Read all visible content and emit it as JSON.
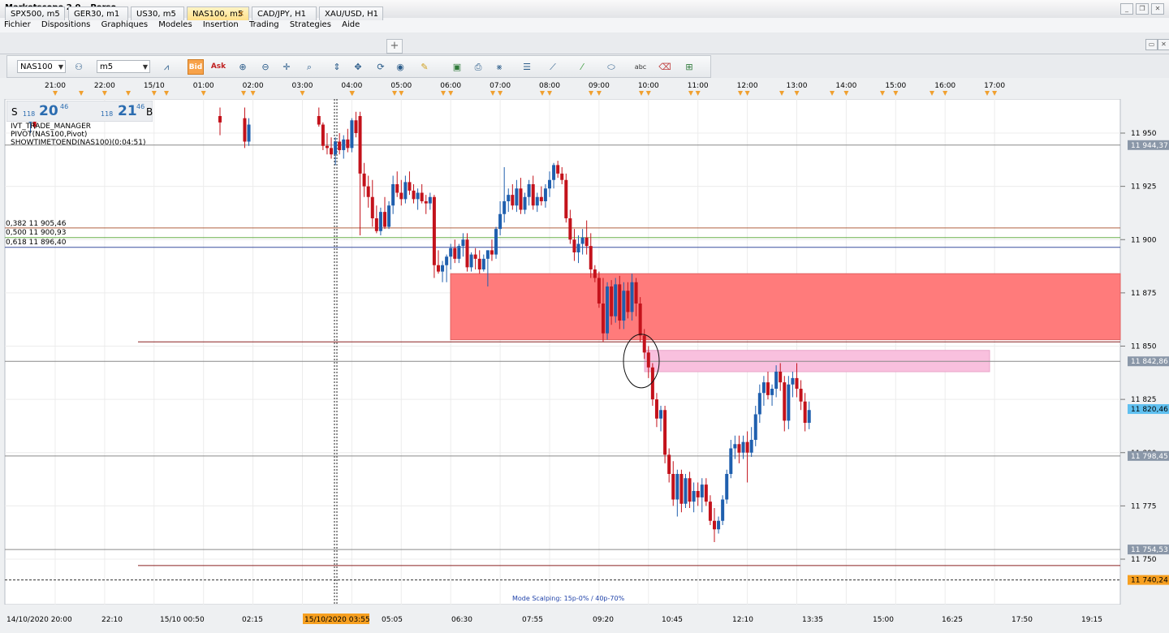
{
  "app": {
    "title": "Marketscope 2.0 – Perso",
    "window_buttons": [
      "_",
      "❐",
      "✕"
    ]
  },
  "menu": [
    "Fichier",
    "Dispositions",
    "Graphiques",
    "Modeles",
    "Insertion",
    "Trading",
    "Strategies",
    "Aide"
  ],
  "tabs": [
    {
      "label": "SPX500, m5",
      "active": false
    },
    {
      "label": "GER30, m1",
      "active": false
    },
    {
      "label": "US30, m5",
      "active": false
    },
    {
      "label": "NAS100, m5",
      "active": true
    },
    {
      "label": "CAD/JPY, H1",
      "active": false
    },
    {
      "label": "XAU/USD, H1",
      "active": false
    }
  ],
  "toolbar": {
    "instrument": "NAS100",
    "timeframe": "m5",
    "bid_label": "Bid",
    "ask_label": "Ask"
  },
  "quote": {
    "sell_label": "S",
    "sell_small": "118",
    "sell_big": "20",
    "sell_sup": "46",
    "buy_small": "118",
    "buy_big": "21",
    "buy_sup": "46",
    "buy_label": "B"
  },
  "indicators": [
    "IVT_TRADE_MANAGER",
    "PIVOT(NAS100,Pivot)",
    "SHOWTIMETOEND(NAS100)(0:04:51)"
  ],
  "fib_labels": [
    "0,382 11 905,46",
    "0,500 11 900,93",
    "0,618 11 896,40"
  ],
  "mode_label": "Mode Scalping: 15p-0% / 40p-70%",
  "colors": {
    "bull": "#1f5fae",
    "bear": "#c3121b",
    "zone_red": "#ff7b7b",
    "zone_pink": "#f9c0de",
    "accent": "#f7a24a"
  },
  "chart_data": {
    "type": "candlestick",
    "symbol": "NAS100",
    "timeframe": "m5",
    "ylim": [
      11732,
      11960
    ],
    "y_ticks": [
      "11 950",
      "11 925",
      "11 900",
      "11 875",
      "11 850",
      "11 825",
      "11 800",
      "11 775",
      "11 750"
    ],
    "top_time_labels": [
      "21:00",
      "22:00",
      "15/10",
      "01:00",
      "02:00",
      "03:00",
      "04:00",
      "05:00",
      "06:00",
      "07:00",
      "08:00",
      "09:00",
      "10:00",
      "11:00",
      "12:00",
      "13:00",
      "14:00",
      "15:00",
      "16:00",
      "17:00"
    ],
    "bottom_time_labels": [
      "14/10/2020 20:00",
      "22:10",
      "15/10 00:50",
      "02:15",
      "03:40",
      "15/10/2020 03:55",
      "05:05",
      "06:30",
      "07:55",
      "09:20",
      "10:45",
      "12:10",
      "13:35",
      "15:00",
      "16:25",
      "17:50",
      "19:15"
    ],
    "price_tags": [
      {
        "label": "11 944,37",
        "value": 11944.37,
        "style": "gray"
      },
      {
        "label": "11 842,86",
        "value": 11842.86,
        "style": "gray"
      },
      {
        "label": "11 820,46",
        "value": 11820.46,
        "style": "blue"
      },
      {
        "label": "11 798,45",
        "value": 11798.45,
        "style": "gray"
      },
      {
        "label": "11 754,53",
        "value": 11754.53,
        "style": "gray"
      },
      {
        "label": "11 740,24",
        "value": 11740.24,
        "style": "orange"
      }
    ],
    "horizontal_lines": [
      {
        "value": 11944.37,
        "color": "#8a8a8a"
      },
      {
        "value": 11905.46,
        "color": "#b06040"
      },
      {
        "value": 11900.93,
        "color": "#6ab04c"
      },
      {
        "value": 11896.4,
        "color": "#3a50a0"
      },
      {
        "value": 11852,
        "color": "#8b2020"
      },
      {
        "value": 11842.86,
        "color": "#8a8a8a"
      },
      {
        "value": 11798.45,
        "color": "#8a8a8a"
      },
      {
        "value": 11754.53,
        "color": "#8a8a8a"
      },
      {
        "value": 11747,
        "color": "#8b2020"
      },
      {
        "value": 11740.24,
        "color": "#333333",
        "dashed": true
      }
    ],
    "zones": [
      {
        "name": "supply-zone",
        "from_time": "06:20",
        "to_time": "end",
        "high": 11884,
        "low": 11853,
        "color": "#ff7b7b"
      },
      {
        "name": "imbalance-zone",
        "from_time": "09:55",
        "to_time": "16:55",
        "high": 11848,
        "low": 11838,
        "color": "#f9c0de"
      }
    ],
    "candles": [
      [
        "20:30",
        11955,
        11960,
        11950,
        11957
      ],
      [
        "20:35",
        11957,
        11962,
        11952,
        11953
      ],
      [
        "00:20",
        11958,
        11962,
        11949,
        11955
      ],
      [
        "00:50",
        11957,
        11962,
        11943,
        11946
      ],
      [
        "00:55",
        11946,
        11957,
        11944,
        11954
      ],
      [
        "02:20",
        11958,
        11962,
        11953,
        11954
      ],
      [
        "02:25",
        11954,
        11955,
        11942,
        11944
      ],
      [
        "02:30",
        11944,
        11950,
        11940,
        11943
      ],
      [
        "02:35",
        11943,
        11948,
        11938,
        11940
      ],
      [
        "02:40",
        11940,
        11948,
        11935,
        11946
      ],
      [
        "02:45",
        11946,
        11950,
        11940,
        11942
      ],
      [
        "02:50",
        11942,
        11949,
        11938,
        11947
      ],
      [
        "02:55",
        11947,
        11952,
        11941,
        11943
      ],
      [
        "03:00",
        11943,
        11957,
        11941,
        11956
      ],
      [
        "03:05",
        11956,
        11960,
        11948,
        11950
      ],
      [
        "03:10",
        11958,
        11960,
        11902,
        11931
      ],
      [
        "03:15",
        11931,
        11936,
        11920,
        11925
      ],
      [
        "03:20",
        11925,
        11930,
        11915,
        11920
      ],
      [
        "03:25",
        11920,
        11928,
        11906,
        11910
      ],
      [
        "03:30",
        11910,
        11916,
        11903,
        11904
      ],
      [
        "03:35",
        11904,
        11915,
        11902,
        11913
      ],
      [
        "03:40",
        11913,
        11920,
        11905,
        11906
      ],
      [
        "03:45",
        11906,
        11918,
        11905,
        11916
      ],
      [
        "03:50",
        11916,
        11930,
        11912,
        11926
      ],
      [
        "03:55",
        11926,
        11932,
        11920,
        11922
      ],
      [
        "04:00",
        11922,
        11928,
        11916,
        11919
      ],
      [
        "04:05",
        11919,
        11930,
        11917,
        11927
      ],
      [
        "04:10",
        11927,
        11932,
        11921,
        11923
      ],
      [
        "04:15",
        11923,
        11926,
        11917,
        11919
      ],
      [
        "04:20",
        11919,
        11924,
        11914,
        11922
      ],
      [
        "04:25",
        11922,
        11926,
        11917,
        11918
      ],
      [
        "04:30",
        11918,
        11921,
        11912,
        11917
      ],
      [
        "04:35",
        11917,
        11922,
        11914,
        11920
      ],
      [
        "04:40",
        11920,
        11921,
        11882,
        11888
      ],
      [
        "04:45",
        11888,
        11895,
        11884,
        11885
      ],
      [
        "04:50",
        11885,
        11890,
        11880,
        11888
      ],
      [
        "04:55",
        11888,
        11893,
        11880,
        11892
      ],
      [
        "05:00",
        11892,
        11898,
        11886,
        11896
      ],
      [
        "05:05",
        11896,
        11900,
        11889,
        11891
      ],
      [
        "05:10",
        11891,
        11898,
        11889,
        11897
      ],
      [
        "05:15",
        11897,
        11903,
        11892,
        11900
      ],
      [
        "05:20",
        11900,
        11903,
        11885,
        11887
      ],
      [
        "05:25",
        11887,
        11894,
        11885,
        11893
      ],
      [
        "05:30",
        11893,
        11896,
        11886,
        11891
      ],
      [
        "05:35",
        11891,
        11895,
        11884,
        11886
      ],
      [
        "05:40",
        11886,
        11893,
        11885,
        11891
      ],
      [
        "05:45",
        11891,
        11895,
        11878,
        11895
      ],
      [
        "05:50",
        11895,
        11900,
        11890,
        11893
      ],
      [
        "05:55",
        11893,
        11906,
        11891,
        11905
      ],
      [
        "06:00",
        11905,
        11918,
        11902,
        11912
      ],
      [
        "06:05",
        11912,
        11934,
        11908,
        11918
      ],
      [
        "06:10",
        11918,
        11924,
        11913,
        11921
      ],
      [
        "06:15",
        11921,
        11926,
        11914,
        11916
      ],
      [
        "06:20",
        11916,
        11928,
        11913,
        11924
      ],
      [
        "06:25",
        11924,
        11929,
        11912,
        11914
      ],
      [
        "06:30",
        11914,
        11922,
        11912,
        11920
      ],
      [
        "06:35",
        11920,
        11928,
        11916,
        11926
      ],
      [
        "06:40",
        11926,
        11930,
        11914,
        11916
      ],
      [
        "06:45",
        11916,
        11922,
        11913,
        11920
      ],
      [
        "06:50",
        11920,
        11925,
        11916,
        11918
      ],
      [
        "06:55",
        11918,
        11926,
        11915,
        11924
      ],
      [
        "07:00",
        11924,
        11932,
        11920,
        11928
      ],
      [
        "07:05",
        11928,
        11936,
        11924,
        11935
      ],
      [
        "07:10",
        11935,
        11937,
        11929,
        11931
      ],
      [
        "07:15",
        11931,
        11934,
        11926,
        11928
      ],
      [
        "07:20",
        11928,
        11931,
        11908,
        11910
      ],
      [
        "07:25",
        11910,
        11914,
        11898,
        11900
      ],
      [
        "07:30",
        11900,
        11905,
        11890,
        11894
      ],
      [
        "07:35",
        11894,
        11902,
        11889,
        11898
      ],
      [
        "07:40",
        11898,
        11905,
        11893,
        11901
      ],
      [
        "07:45",
        11901,
        11909,
        11893,
        11897
      ],
      [
        "07:50",
        11897,
        11903,
        11882,
        11886
      ],
      [
        "07:55",
        11886,
        11888,
        11880,
        11882
      ],
      [
        "08:00",
        11882,
        11885,
        11868,
        11870
      ],
      [
        "08:05",
        11870,
        11882,
        11852,
        11856
      ],
      [
        "08:10",
        11856,
        11880,
        11853,
        11878
      ],
      [
        "08:15",
        11878,
        11881,
        11860,
        11864
      ],
      [
        "08:20",
        11864,
        11882,
        11861,
        11879
      ],
      [
        "08:25",
        11879,
        11883,
        11858,
        11862
      ],
      [
        "08:30",
        11862,
        11880,
        11858,
        11876
      ],
      [
        "08:35",
        11876,
        11880,
        11863,
        11866
      ],
      [
        "08:40",
        11866,
        11884,
        11862,
        11880
      ],
      [
        "08:45",
        11880,
        11882,
        11864,
        11870
      ],
      [
        "08:50",
        11870,
        11873,
        11852,
        11855
      ],
      [
        "08:55",
        11855,
        11858,
        11844,
        11847
      ],
      [
        "09:00",
        11847,
        11850,
        11835,
        11840
      ],
      [
        "09:05",
        11840,
        11842,
        11822,
        11825
      ],
      [
        "09:10",
        11825,
        11828,
        11812,
        11816
      ],
      [
        "09:15",
        11816,
        11822,
        11810,
        11820
      ],
      [
        "09:20",
        11820,
        11822,
        11795,
        11799
      ],
      [
        "09:25",
        11799,
        11802,
        11786,
        11790
      ],
      [
        "09:30",
        11790,
        11796,
        11775,
        11778
      ],
      [
        "09:35",
        11778,
        11792,
        11770,
        11790
      ],
      [
        "09:40",
        11790,
        11792,
        11772,
        11776
      ],
      [
        "09:45",
        11776,
        11790,
        11774,
        11788
      ],
      [
        "09:50",
        11788,
        11791,
        11774,
        11777
      ],
      [
        "09:55",
        11777,
        11786,
        11772,
        11782
      ],
      [
        "10:00",
        11782,
        11786,
        11775,
        11779
      ],
      [
        "10:05",
        11779,
        11788,
        11772,
        11785
      ],
      [
        "10:10",
        11785,
        11788,
        11775,
        11777
      ],
      [
        "10:15",
        11777,
        11780,
        11766,
        11768
      ],
      [
        "10:20",
        11768,
        11774,
        11758,
        11764
      ],
      [
        "10:25",
        11764,
        11770,
        11762,
        11768
      ],
      [
        "10:30",
        11768,
        11780,
        11766,
        11778
      ],
      [
        "10:35",
        11778,
        11792,
        11776,
        11790
      ],
      [
        "10:40",
        11790,
        11806,
        11788,
        11802
      ],
      [
        "10:45",
        11802,
        11808,
        11797,
        11804
      ],
      [
        "10:50",
        11804,
        11808,
        11795,
        11800
      ],
      [
        "10:55",
        11800,
        11808,
        11797,
        11805
      ],
      [
        "11:00",
        11805,
        11810,
        11786,
        11800
      ],
      [
        "11:05",
        11800,
        11812,
        11798,
        11806
      ],
      [
        "11:10",
        11806,
        11822,
        11803,
        11818
      ],
      [
        "11:15",
        11818,
        11832,
        11814,
        11828
      ],
      [
        "11:20",
        11828,
        11836,
        11822,
        11833
      ],
      [
        "11:25",
        11833,
        11838,
        11825,
        11827
      ],
      [
        "11:30",
        11827,
        11832,
        11822,
        11830
      ],
      [
        "11:35",
        11830,
        11841,
        11826,
        11838
      ],
      [
        "11:40",
        11838,
        11842,
        11829,
        11833
      ],
      [
        "11:45",
        11833,
        11836,
        11810,
        11815
      ],
      [
        "11:50",
        11815,
        11836,
        11811,
        11832
      ],
      [
        "11:55",
        11832,
        11838,
        11826,
        11835
      ],
      [
        "12:00",
        11835,
        11842,
        11826,
        11830
      ],
      [
        "12:05",
        11830,
        11834,
        11820,
        11824
      ],
      [
        "12:10",
        11824,
        11828,
        11810,
        11814
      ],
      [
        "12:15",
        11814,
        11824,
        11811,
        11820
      ]
    ],
    "annotations": [
      {
        "type": "ellipse",
        "time": "09:00",
        "price": 11843
      }
    ]
  }
}
